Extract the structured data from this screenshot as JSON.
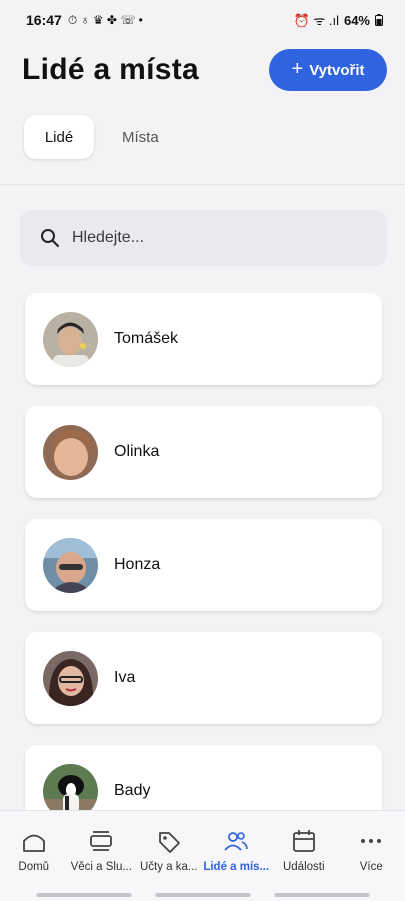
{
  "status_bar": {
    "time": "16:47",
    "left_icons": "⏱ ♁ ♛ ✤ ☏ •",
    "right_icons": "⏰ ᯤ .ıl",
    "battery": "64%"
  },
  "header": {
    "title": "Lidé a místa",
    "create_label": "Vytvořit",
    "create_icon": "plus-icon"
  },
  "tabs": [
    {
      "label": "Lidé",
      "active": true
    },
    {
      "label": "Místa",
      "active": false
    }
  ],
  "search": {
    "placeholder": "Hledejte...",
    "icon": "search-icon"
  },
  "people": [
    {
      "name": "Tomášek"
    },
    {
      "name": "Olinka"
    },
    {
      "name": "Honza"
    },
    {
      "name": "Iva"
    },
    {
      "name": "Bady"
    }
  ],
  "bottom_nav": [
    {
      "label": "Domů",
      "icon": "home-icon"
    },
    {
      "label": "Věci a Slu...",
      "icon": "items-icon"
    },
    {
      "label": "Účty a ka...",
      "icon": "tag-icon"
    },
    {
      "label": "Lidé a mís...",
      "icon": "people-icon",
      "active": true
    },
    {
      "label": "Události",
      "icon": "calendar-icon"
    },
    {
      "label": "Více",
      "icon": "more-icon"
    }
  ],
  "colors": {
    "accent": "#2f63e0",
    "background": "#f3f3f5"
  }
}
